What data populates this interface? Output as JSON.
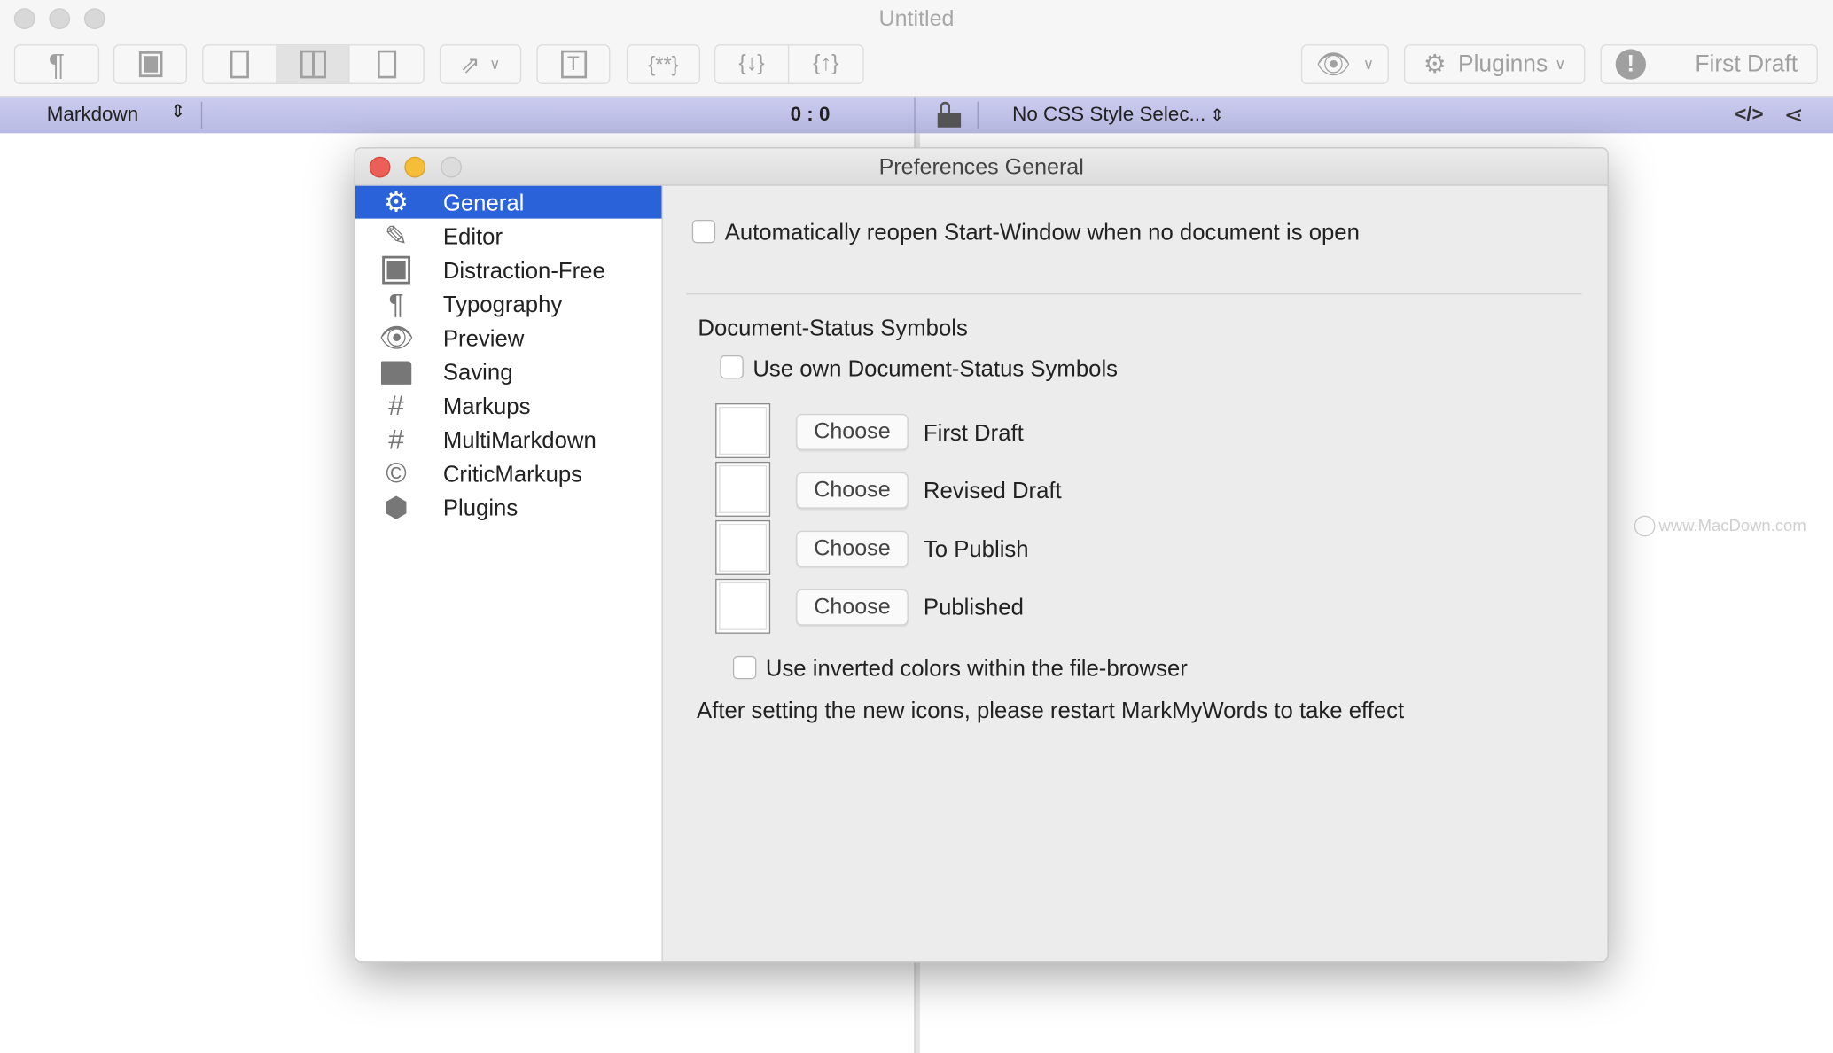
{
  "window": {
    "title": "Untitled"
  },
  "toolbar": {
    "plugins_label": "Pluginns",
    "status_label": "First Draft"
  },
  "statusbar": {
    "syntax": "Markdown",
    "position": "0 : 0",
    "css_style": "No CSS Style Selec..."
  },
  "watermark": "www.MacDown.com",
  "dialog": {
    "title": "Preferences General",
    "sidebar": {
      "selected": "General",
      "items": [
        {
          "label": "General",
          "icon": "gear-icon"
        },
        {
          "label": "Editor",
          "icon": "pencil-icon"
        },
        {
          "label": "Distraction-Free",
          "icon": "square-icon"
        },
        {
          "label": "Typography",
          "icon": "pilcrow-icon"
        },
        {
          "label": "Preview",
          "icon": "eye-icon"
        },
        {
          "label": "Saving",
          "icon": "folder-icon"
        },
        {
          "label": "Markups",
          "icon": "hash-icon"
        },
        {
          "label": "MultiMarkdown",
          "icon": "hash-icon"
        },
        {
          "label": "CriticMarkups",
          "icon": "copyright-icon"
        },
        {
          "label": "Plugins",
          "icon": "cube-icon"
        }
      ]
    },
    "general": {
      "reopen_label": "Automatically reopen Start-Window when no document is open",
      "reopen_checked": false,
      "section_title": "Document-Status Symbols",
      "own_symbols_label": "Use own Document-Status Symbols",
      "own_symbols_checked": false,
      "choose_label": "Choose",
      "statuses": [
        "First Draft",
        "Revised Draft",
        "To Publish",
        "Published"
      ],
      "inverted_label": "Use inverted colors within the file-browser",
      "inverted_checked": false,
      "note": "After setting the new icons, please restart MarkMyWords to take effect"
    }
  },
  "colors": {
    "accent": "#2a62d9",
    "statusbar": "#c5c6ec"
  }
}
